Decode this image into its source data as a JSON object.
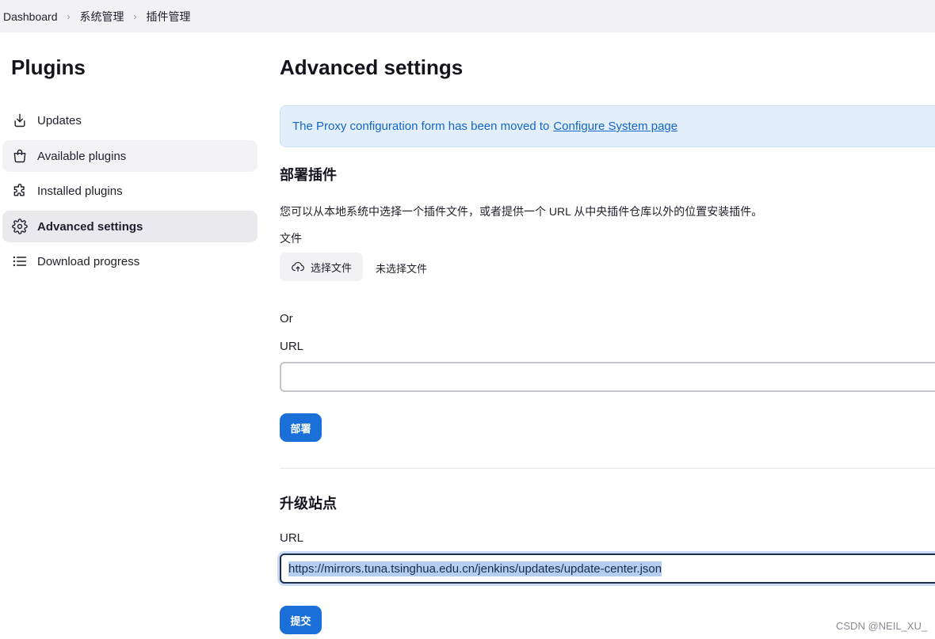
{
  "breadcrumb": [
    "Dashboard",
    "系统管理",
    "插件管理"
  ],
  "sidebar": {
    "title": "Plugins",
    "items": [
      {
        "label": "Updates",
        "icon": "download-icon"
      },
      {
        "label": "Available plugins",
        "icon": "shopping-bag-icon"
      },
      {
        "label": "Installed plugins",
        "icon": "puzzle-icon"
      },
      {
        "label": "Advanced settings",
        "icon": "gear-icon"
      },
      {
        "label": "Download progress",
        "icon": "list-icon"
      }
    ]
  },
  "main": {
    "title": "Advanced settings",
    "notice": {
      "text": "The Proxy configuration form has been moved to",
      "link": "Configure System page"
    },
    "deploy": {
      "heading": "部署插件",
      "description": "您可以从本地系统中选择一个插件文件，或者提供一个 URL 从中央插件仓库以外的位置安装插件。",
      "file_label": "文件",
      "file_button": "选择文件",
      "file_status": "未选择文件",
      "or_label": "Or",
      "url_label": "URL",
      "url_value": "",
      "submit": "部署"
    },
    "update_site": {
      "heading": "升级站点",
      "url_label": "URL",
      "url_value": "https://mirrors.tuna.tsinghua.edu.cn/jenkins/updates/update-center.json",
      "submit": "提交"
    }
  },
  "watermark": "CSDN @NEIL_XU_",
  "colors": {
    "accent": "#1b6fd8",
    "notice_bg": "#e3eefb",
    "notice_text": "#1366c9",
    "active_bg": "#e9e9ee"
  }
}
